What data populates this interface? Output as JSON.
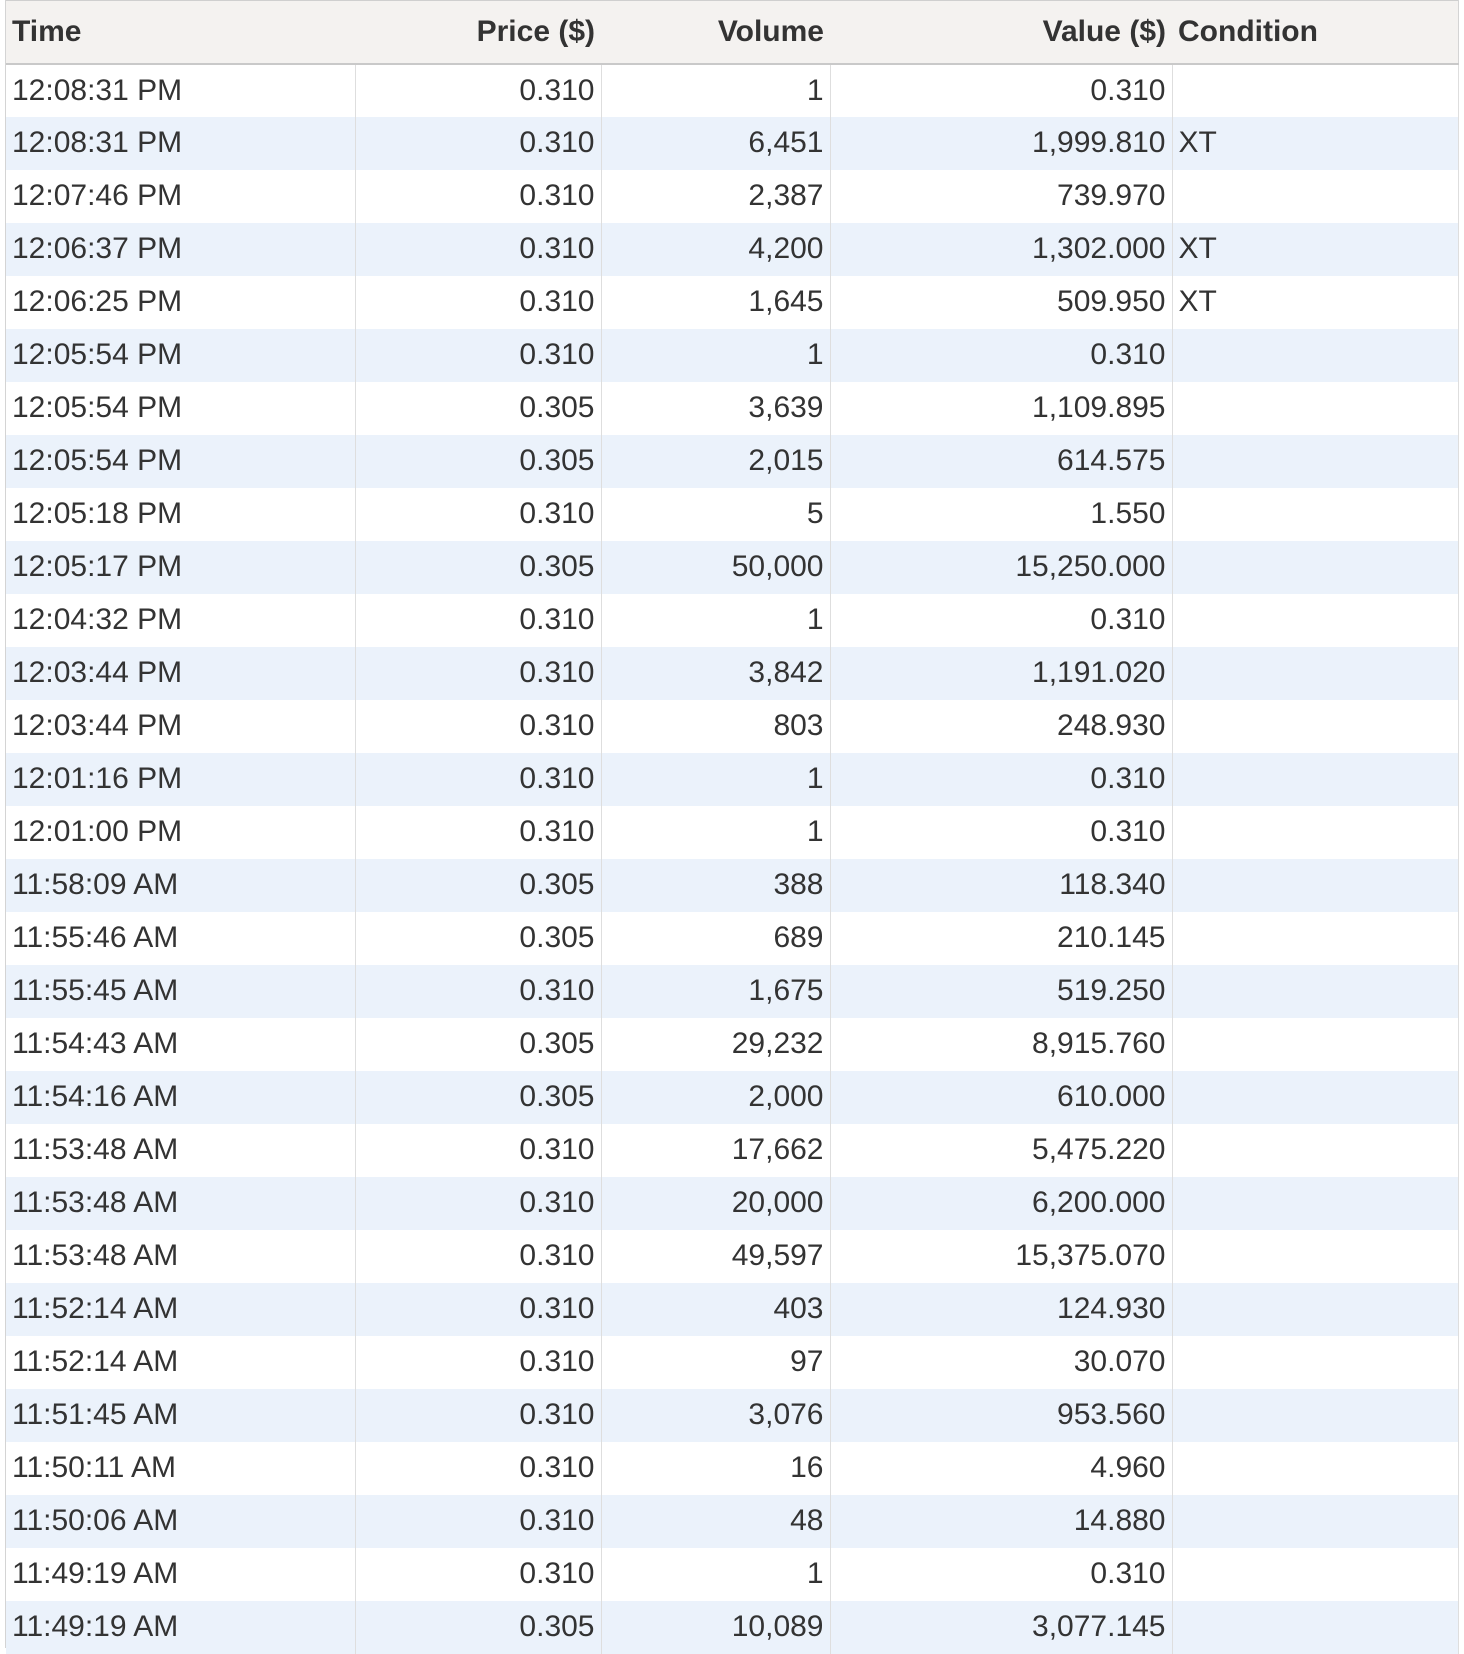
{
  "table": {
    "headers": {
      "time": "Time",
      "price": "Price ($)",
      "volume": "Volume",
      "value": "Value ($)",
      "condition": "Condition"
    },
    "rows": [
      {
        "time": "12:08:31 PM",
        "price": "0.310",
        "volume": "1",
        "value": "0.310",
        "condition": ""
      },
      {
        "time": "12:08:31 PM",
        "price": "0.310",
        "volume": "6,451",
        "value": "1,999.810",
        "condition": "XT"
      },
      {
        "time": "12:07:46 PM",
        "price": "0.310",
        "volume": "2,387",
        "value": "739.970",
        "condition": ""
      },
      {
        "time": "12:06:37 PM",
        "price": "0.310",
        "volume": "4,200",
        "value": "1,302.000",
        "condition": "XT"
      },
      {
        "time": "12:06:25 PM",
        "price": "0.310",
        "volume": "1,645",
        "value": "509.950",
        "condition": "XT"
      },
      {
        "time": "12:05:54 PM",
        "price": "0.310",
        "volume": "1",
        "value": "0.310",
        "condition": ""
      },
      {
        "time": "12:05:54 PM",
        "price": "0.305",
        "volume": "3,639",
        "value": "1,109.895",
        "condition": ""
      },
      {
        "time": "12:05:54 PM",
        "price": "0.305",
        "volume": "2,015",
        "value": "614.575",
        "condition": ""
      },
      {
        "time": "12:05:18 PM",
        "price": "0.310",
        "volume": "5",
        "value": "1.550",
        "condition": ""
      },
      {
        "time": "12:05:17 PM",
        "price": "0.305",
        "volume": "50,000",
        "value": "15,250.000",
        "condition": ""
      },
      {
        "time": "12:04:32 PM",
        "price": "0.310",
        "volume": "1",
        "value": "0.310",
        "condition": ""
      },
      {
        "time": "12:03:44 PM",
        "price": "0.310",
        "volume": "3,842",
        "value": "1,191.020",
        "condition": ""
      },
      {
        "time": "12:03:44 PM",
        "price": "0.310",
        "volume": "803",
        "value": "248.930",
        "condition": ""
      },
      {
        "time": "12:01:16 PM",
        "price": "0.310",
        "volume": "1",
        "value": "0.310",
        "condition": ""
      },
      {
        "time": "12:01:00 PM",
        "price": "0.310",
        "volume": "1",
        "value": "0.310",
        "condition": ""
      },
      {
        "time": "11:58:09 AM",
        "price": "0.305",
        "volume": "388",
        "value": "118.340",
        "condition": ""
      },
      {
        "time": "11:55:46 AM",
        "price": "0.305",
        "volume": "689",
        "value": "210.145",
        "condition": ""
      },
      {
        "time": "11:55:45 AM",
        "price": "0.310",
        "volume": "1,675",
        "value": "519.250",
        "condition": ""
      },
      {
        "time": "11:54:43 AM",
        "price": "0.305",
        "volume": "29,232",
        "value": "8,915.760",
        "condition": ""
      },
      {
        "time": "11:54:16 AM",
        "price": "0.305",
        "volume": "2,000",
        "value": "610.000",
        "condition": ""
      },
      {
        "time": "11:53:48 AM",
        "price": "0.310",
        "volume": "17,662",
        "value": "5,475.220",
        "condition": ""
      },
      {
        "time": "11:53:48 AM",
        "price": "0.310",
        "volume": "20,000",
        "value": "6,200.000",
        "condition": ""
      },
      {
        "time": "11:53:48 AM",
        "price": "0.310",
        "volume": "49,597",
        "value": "15,375.070",
        "condition": ""
      },
      {
        "time": "11:52:14 AM",
        "price": "0.310",
        "volume": "403",
        "value": "124.930",
        "condition": ""
      },
      {
        "time": "11:52:14 AM",
        "price": "0.310",
        "volume": "97",
        "value": "30.070",
        "condition": ""
      },
      {
        "time": "11:51:45 AM",
        "price": "0.310",
        "volume": "3,076",
        "value": "953.560",
        "condition": ""
      },
      {
        "time": "11:50:11 AM",
        "price": "0.310",
        "volume": "16",
        "value": "4.960",
        "condition": ""
      },
      {
        "time": "11:50:06 AM",
        "price": "0.310",
        "volume": "48",
        "value": "14.880",
        "condition": ""
      },
      {
        "time": "11:49:19 AM",
        "price": "0.310",
        "volume": "1",
        "value": "0.310",
        "condition": ""
      },
      {
        "time": "11:49:19 AM",
        "price": "0.305",
        "volume": "10,089",
        "value": "3,077.145",
        "condition": ""
      }
    ]
  }
}
